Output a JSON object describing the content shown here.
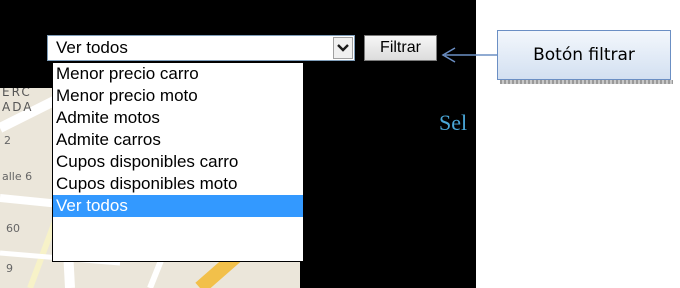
{
  "dropdown": {
    "selected_value": "Ver todos",
    "options": [
      "Menor precio carro",
      "Menor precio moto",
      "Admite motos",
      "Admite carros",
      "Cupos disponibles carro",
      "Cupos disponibles moto",
      "Ver todos"
    ],
    "highlighted_option": "Ver todos"
  },
  "filter_button": {
    "label": "Filtrar"
  },
  "side_text": "Sel",
  "callout": {
    "label": "Botón filtrar"
  },
  "map": {
    "label_line1": "ERC",
    "label_line2": "ADA",
    "small_1": "2",
    "small_2": "alle 6",
    "small_3": "60",
    "small_4": "9"
  },
  "colors": {
    "highlight": "#3399ff",
    "callout_border": "#6b8fc4",
    "side_text": "#4aa7d8"
  },
  "icons": {
    "select_arrow": "chevron-down-icon",
    "callout_arrow": "arrow-left-icon"
  }
}
